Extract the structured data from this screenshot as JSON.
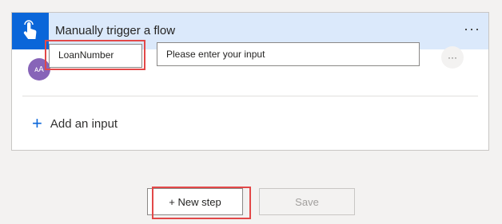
{
  "trigger": {
    "title": "Manually trigger a flow",
    "menu_label": "···",
    "icon": "hand-tap-icon",
    "accent_color": "#0a66d9",
    "header_bg": "#dbe9fb"
  },
  "input_row": {
    "avatar_text": "ᴀA",
    "name_value": "LoanNumber",
    "description_value": "Please enter your input",
    "menu_label": "···"
  },
  "add_input": {
    "icon_text": "+",
    "label": "Add an input"
  },
  "footer": {
    "new_step_label": "+ New step",
    "save_label": "Save"
  },
  "highlight_color": "#e24848"
}
